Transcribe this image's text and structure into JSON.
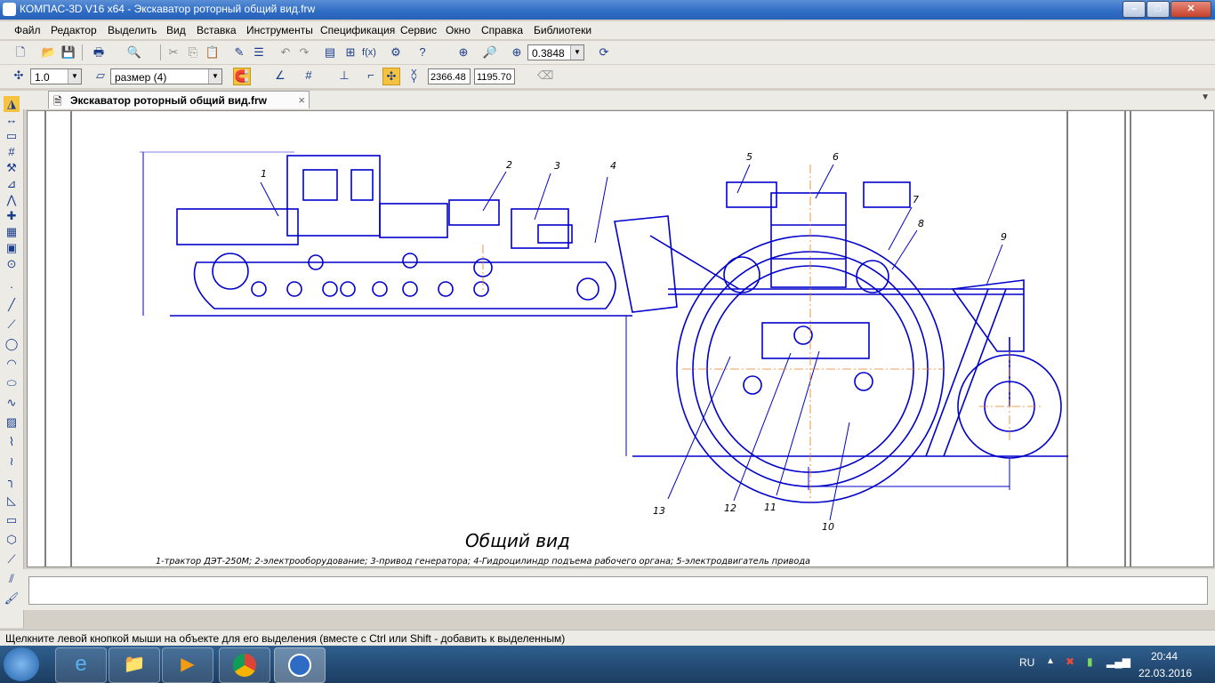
{
  "window": {
    "title": "КОМПАС-3D V16  x64 - Экскаватор роторный общий вид.frw",
    "minimize": "–",
    "maximize": "□",
    "close": "✕"
  },
  "menu": [
    "Файл",
    "Редактор",
    "Выделить",
    "Вид",
    "Вставка",
    "Инструменты",
    "Спецификация",
    "Сервис",
    "Окно",
    "Справка",
    "Библиотеки"
  ],
  "toolbar1": {
    "zoom_value": "0.3848",
    "icons": [
      "new-file-icon",
      "open-icon",
      "save-icon",
      "print-icon",
      "preview-icon",
      "cut-icon",
      "copy-icon",
      "paste-icon",
      "properties-icon",
      "layers-icon",
      "undo-icon",
      "redo-icon",
      "manager-icon",
      "tree-icon",
      "variables-icon",
      "parameters-icon",
      "help-icon",
      "zoom-window-icon",
      "zoom-icon",
      "zoom-in-icon",
      "refresh-icon"
    ]
  },
  "toolbar2": {
    "scale_value": "1.0",
    "style_value": "размер (4)",
    "x_label": "X",
    "y_label": "Y",
    "x_value": "2366.48",
    "y_value": "1195.70"
  },
  "tab": {
    "label": "Экскаватор роторный общий вид.frw",
    "close": "×"
  },
  "drawing": {
    "title": "Общий вид",
    "caption": "1-трактор ДЭТ-250М; 2-электрооборудование; 3-привод генератора; 4-Гидроцилиндр подъема рабочего органа; 5-электродвигатель привода",
    "callouts": [
      "1",
      "2",
      "3",
      "4",
      "5",
      "6",
      "7",
      "8",
      "9",
      "10",
      "11",
      "12",
      "13"
    ]
  },
  "status": {
    "hint": "Щелкните левой кнопкой мыши на объекте для его выделения (вместе с Ctrl или Shift - добавить к выделенным)"
  },
  "taskbar": {
    "apps": [
      "start-icon",
      "internet-explorer-icon",
      "file-explorer-icon",
      "media-player-icon",
      "chrome-icon",
      "kompas-icon"
    ],
    "lang": "RU",
    "time": "20:44",
    "date": "22.03.2016"
  },
  "colors": {
    "drawing_line": "#0000cc",
    "center_line": "#e67e22",
    "title_bar": "#2d6bc4"
  }
}
